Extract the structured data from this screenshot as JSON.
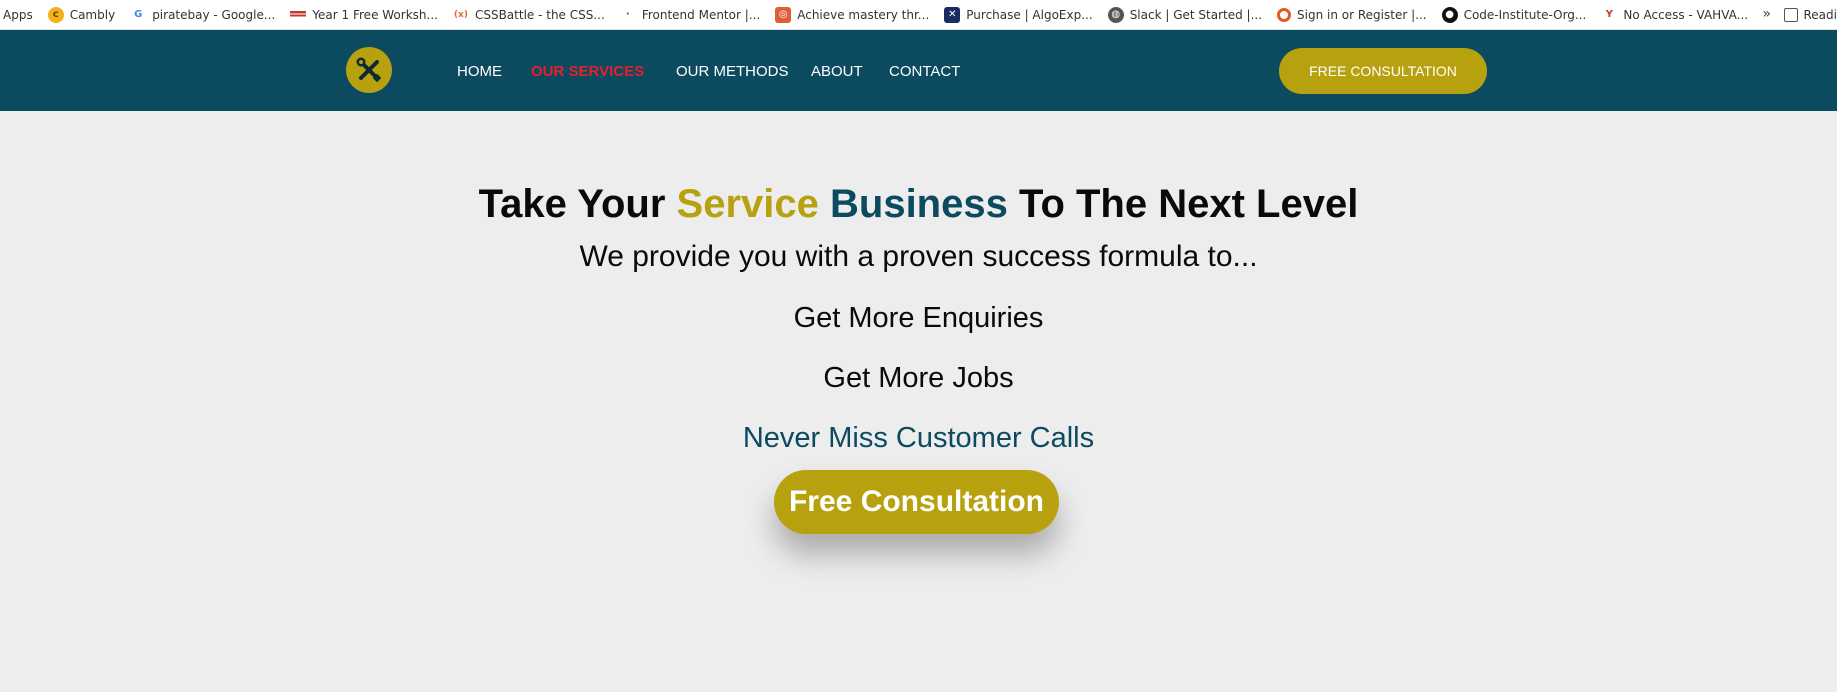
{
  "bookmarks": [
    {
      "label": "Apps",
      "icon": "apps-grid-icon"
    },
    {
      "label": "Cambly",
      "icon": "cambly-icon",
      "color": "#f2b21b"
    },
    {
      "label": "piratebay - Google...",
      "icon": "google-icon",
      "color": "#4285f4"
    },
    {
      "label": "Year 1 Free Worksh...",
      "icon": "flag-icon",
      "color": "#c0392b"
    },
    {
      "label": "CSSBattle - the CSS...",
      "icon": "cssbattle-icon",
      "color": "#e66c36"
    },
    {
      "label": "Frontend Mentor |...",
      "icon": "frontend-mentor-icon",
      "color": "#3e54a3"
    },
    {
      "label": "Achieve mastery thr...",
      "icon": "codewars-icon",
      "color": "#e05d3a"
    },
    {
      "label": "Purchase | AlgoExp...",
      "icon": "algoexpert-icon",
      "color": "#1a2b5f"
    },
    {
      "label": "Slack | Get Started |...",
      "icon": "globe-icon",
      "color": "#555555"
    },
    {
      "label": "Sign in or Register |...",
      "icon": "ring-icon",
      "color": "#e25b1c"
    },
    {
      "label": "Code-Institute-Org...",
      "icon": "github-icon",
      "color": "#111111"
    },
    {
      "label": "No Access - VAHVA...",
      "icon": "vahva-icon",
      "color": "#c0392b"
    }
  ],
  "bookmarks_overflow": "»",
  "reading_list": "Readi",
  "header": {
    "logo_icon": "tools-icon",
    "nav": [
      {
        "label": "HOME",
        "active": false
      },
      {
        "label": "OUR SERVICES",
        "active": true
      },
      {
        "label": "OUR METHODS",
        "active": false
      },
      {
        "label": "ABOUT",
        "active": false
      },
      {
        "label": "CONTACT",
        "active": false
      }
    ],
    "cta_label": "FREE CONSULTATION"
  },
  "hero": {
    "title_part1": "Take Your ",
    "title_gold": "Service",
    "title_space": " ",
    "title_teal": "Business",
    "title_part2": " To The Next Level",
    "subtitle": "We provide you with a proven success formula to...",
    "items": [
      "Get More Enquiries",
      "Get More Jobs",
      "Never Miss Customer Calls"
    ],
    "cta_label": "Free Consultation"
  },
  "colors": {
    "brand_teal": "#0c4a60",
    "brand_gold": "#b8a10f",
    "active_red": "#e5202b",
    "background": "#ecedec"
  }
}
